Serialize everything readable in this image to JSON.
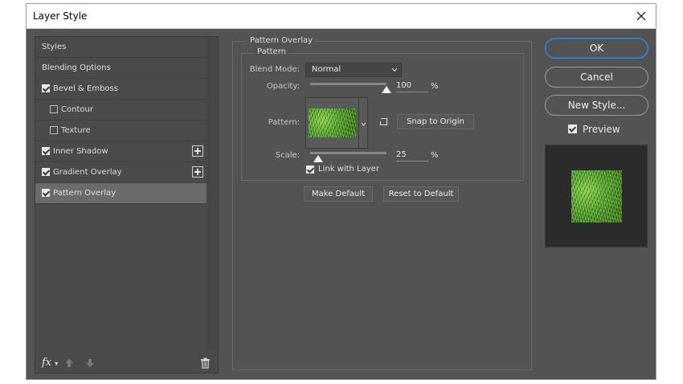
{
  "window": {
    "title": "Layer Style"
  },
  "styles_list": {
    "items": [
      {
        "label": "Styles",
        "checkbox": false,
        "checked": false,
        "indent": false,
        "plus": false,
        "selected": false
      },
      {
        "label": "Blending Options",
        "checkbox": false,
        "checked": false,
        "indent": false,
        "plus": false,
        "selected": false
      },
      {
        "label": "Bevel & Emboss",
        "checkbox": true,
        "checked": true,
        "indent": false,
        "plus": false,
        "selected": false
      },
      {
        "label": "Contour",
        "checkbox": true,
        "checked": false,
        "indent": true,
        "plus": false,
        "selected": false
      },
      {
        "label": "Texture",
        "checkbox": true,
        "checked": false,
        "indent": true,
        "plus": false,
        "selected": false
      },
      {
        "label": "Inner Shadow",
        "checkbox": true,
        "checked": true,
        "indent": false,
        "plus": true,
        "selected": false
      },
      {
        "label": "Gradient Overlay",
        "checkbox": true,
        "checked": true,
        "indent": false,
        "plus": true,
        "selected": false
      },
      {
        "label": "Pattern Overlay",
        "checkbox": true,
        "checked": true,
        "indent": false,
        "plus": false,
        "selected": true
      }
    ],
    "fx_label": "fx"
  },
  "pattern_overlay": {
    "group_title": "Pattern Overlay",
    "subgroup_title": "Pattern",
    "blend_mode_label": "Blend Mode:",
    "blend_mode_value": "Normal",
    "opacity_label": "Opacity:",
    "opacity_value": "100",
    "opacity_unit": "%",
    "opacity_fraction": 1.0,
    "pattern_label": "Pattern:",
    "snap_button": "Snap to Origin",
    "scale_label": "Scale:",
    "scale_value": "25",
    "scale_unit": "%",
    "scale_fraction": 0.1,
    "link_label": "Link with Layer",
    "link_checked": true,
    "make_default": "Make Default",
    "reset_default": "Reset to Default"
  },
  "actions": {
    "ok": "OK",
    "cancel": "Cancel",
    "new_style": "New Style...",
    "preview_label": "Preview",
    "preview_checked": true
  },
  "colors": {
    "dialog_bg": "#535353",
    "selected_row": "#6b6b6b",
    "ok_border": "#3a8ad6",
    "pattern_green": "#4a9a2a"
  }
}
